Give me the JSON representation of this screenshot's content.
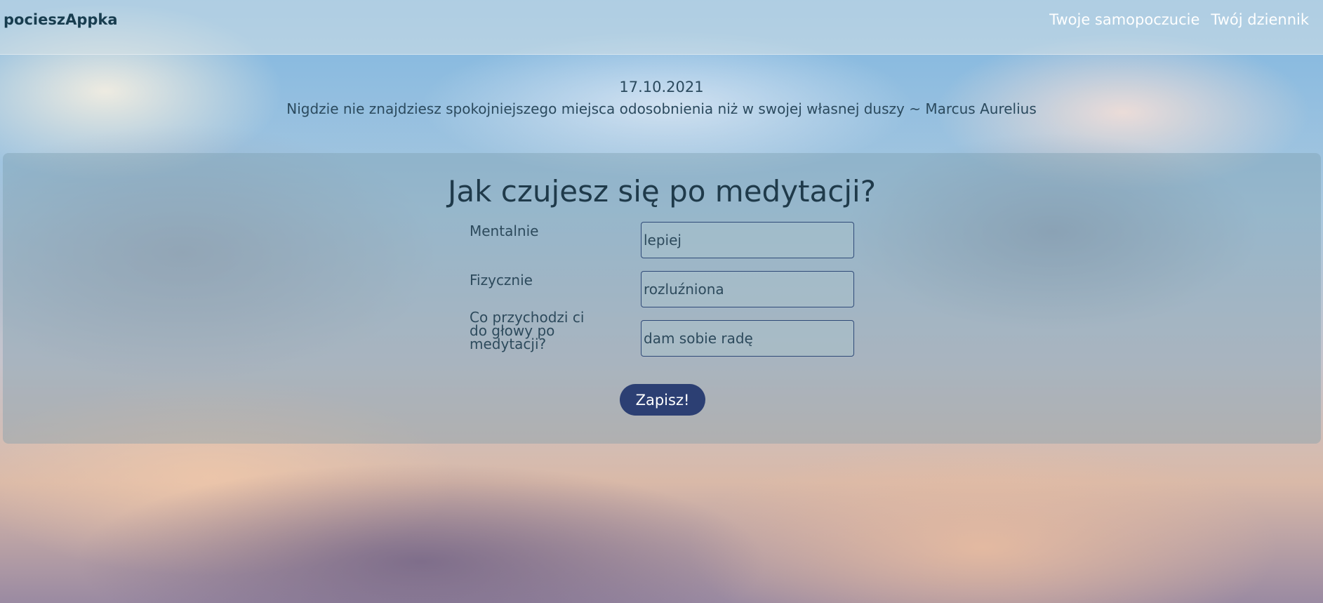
{
  "app": {
    "brand": "pocieszAppka"
  },
  "nav": {
    "links": [
      {
        "label": "Twoje samopoczucie"
      },
      {
        "label": "Twój dziennik"
      }
    ]
  },
  "header": {
    "date": "17.10.2021",
    "quote": "Nigdzie nie znajdziesz spokojniejszego miejsca odosobnienia niż w swojej własnej duszy ~ Marcus Aurelius"
  },
  "form": {
    "title": "Jak czujesz się po medytacji?",
    "fields": [
      {
        "label": "Mentalnie",
        "value": "lepiej"
      },
      {
        "label": "Fizycznie",
        "value": "rozluźniona"
      },
      {
        "label": "Co przychodzi ci do głowy po medytacji?",
        "value": "dam sobie radę"
      }
    ],
    "submit_label": "Zapisz!"
  },
  "colors": {
    "button_bg": "#2c3f73",
    "brand_text": "#183d4f",
    "nav_text": "#ffffff"
  }
}
